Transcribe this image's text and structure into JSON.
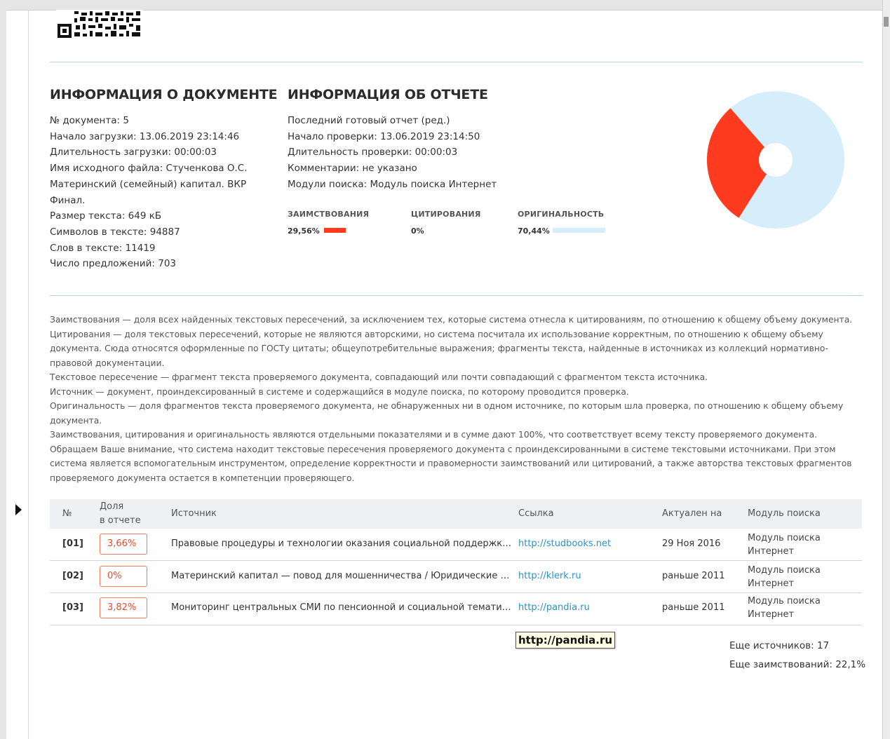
{
  "doc_info": {
    "title": "ИНФОРМАЦИЯ О ДОКУМЕНТЕ",
    "lines": [
      "№ документа: 5",
      "Начало загрузки: 13.06.2019 23:14:46",
      "Длительность загрузки: 00:00:03",
      "Имя исходного файла: Стученкова О.С.",
      "Материнский (семейный) капитал. ВКР",
      "Финал.",
      "Размер текста: 649 кБ",
      "Символов в тексте: 94887",
      "Слов в тексте: 11419",
      "Число предложений: 703"
    ]
  },
  "report_info": {
    "title": "ИНФОРМАЦИЯ ОБ ОТЧЕТЕ",
    "lines": [
      "Последний готовый отчет (ред.)",
      "Начало проверки: 13.06.2019 23:14:50",
      "Длительность проверки: 00:00:03",
      "Комментарии: не указано",
      "Модули поиска: Модуль поиска Интернет"
    ]
  },
  "metrics": [
    {
      "label": "ЗАИМСТВОВАНИЯ",
      "value": "29,56%",
      "fraction": 0.2956,
      "color": "#ff3b1f"
    },
    {
      "label": "ЦИТИРОВАНИЯ",
      "value": "0%",
      "fraction": 0.0,
      "color": "#cccccc"
    },
    {
      "label": "ОРИГИНАЛЬНОСТЬ",
      "value": "70,44%",
      "fraction": 0.7044,
      "color": "#d6eefa"
    }
  ],
  "pie": {
    "slices": [
      {
        "name": "borrowings",
        "fraction": 0.2956,
        "color": "#ff3b1f"
      },
      {
        "name": "originality",
        "fraction": 0.7044,
        "color": "#d6eefa"
      }
    ]
  },
  "legend": [
    "Заимствования — доля всех найденных текстовых пересечений, за исключением тех, которые система отнесла к цитированиям, по отношению к общему объему документа.",
    "Цитирования — доля текстовых пересечений, которые не являются авторскими, но система посчитала их использование корректным, по отношению к общему объему документа. Сюда относятся оформленные по ГОСТу цитаты; общеупотребительные выражения; фрагменты текста, найденные в источниках из коллекций нормативно-правовой документации.",
    "Текстовое пересечение — фрагмент текста проверяемого документа, совпадающий или почти совпадающий с фрагментом текста источника.",
    "Источник — документ, проиндексированный в системе и содержащийся в модуле поиска, по которому проводится проверка.",
    "Оригинальность — доля фрагментов текста проверяемого документа, не обнаруженных ни в одном источнике, по которым шла проверка, по отношению к общему объему документа.",
    "Заимствования, цитирования и оригинальность являются отдельными показателями и в сумме дают 100%, что соответствует всему тексту проверяемого документа.",
    "Обращаем Ваше внимание, что система находит текстовые пересечения проверяемого документа с проиндексированными в системе текстовыми источниками. При этом система является вспомогательным инструментом, определение корректности и правомерности заимствований или цитирований, а также авторства текстовых фрагментов проверяемого документа остается в компетенции проверяющего."
  ],
  "table": {
    "headers": {
      "num": "№",
      "share_line1": "Доля",
      "share_line2": "в отчете",
      "source": "Источник",
      "link": "Ссылка",
      "actual": "Актуален на",
      "module": "Модуль поиска"
    },
    "rows": [
      {
        "num": "[01]",
        "share": "3,66%",
        "source": "Правовые процедуры и технологии оказания социальной поддержки се...",
        "link": "http://studbooks.net",
        "date": "29 Ноя 2016",
        "module_l1": "Модуль поиска",
        "module_l2": "Интернет"
      },
      {
        "num": "[02]",
        "share": "0%",
        "source": "Материнский капитал — повод для мошенничества / Юридические стат...",
        "link": "http://klerk.ru",
        "date": "раньше 2011",
        "module_l1": "Модуль поиска",
        "module_l2": "Интернет"
      },
      {
        "num": "[03]",
        "share": "3,82%",
        "source": "Мониторинг центральных СМИ по пенсионной и социальной тематике ...",
        "link": "http://pandia.ru",
        "date": "раньше 2011",
        "module_l1": "Модуль поиска",
        "module_l2": "Интернет"
      }
    ]
  },
  "tooltip": "http://pandia.ru",
  "more_sources": "Еще источников: 17",
  "more_borrowings": "Еще заимствований: 22,1%"
}
